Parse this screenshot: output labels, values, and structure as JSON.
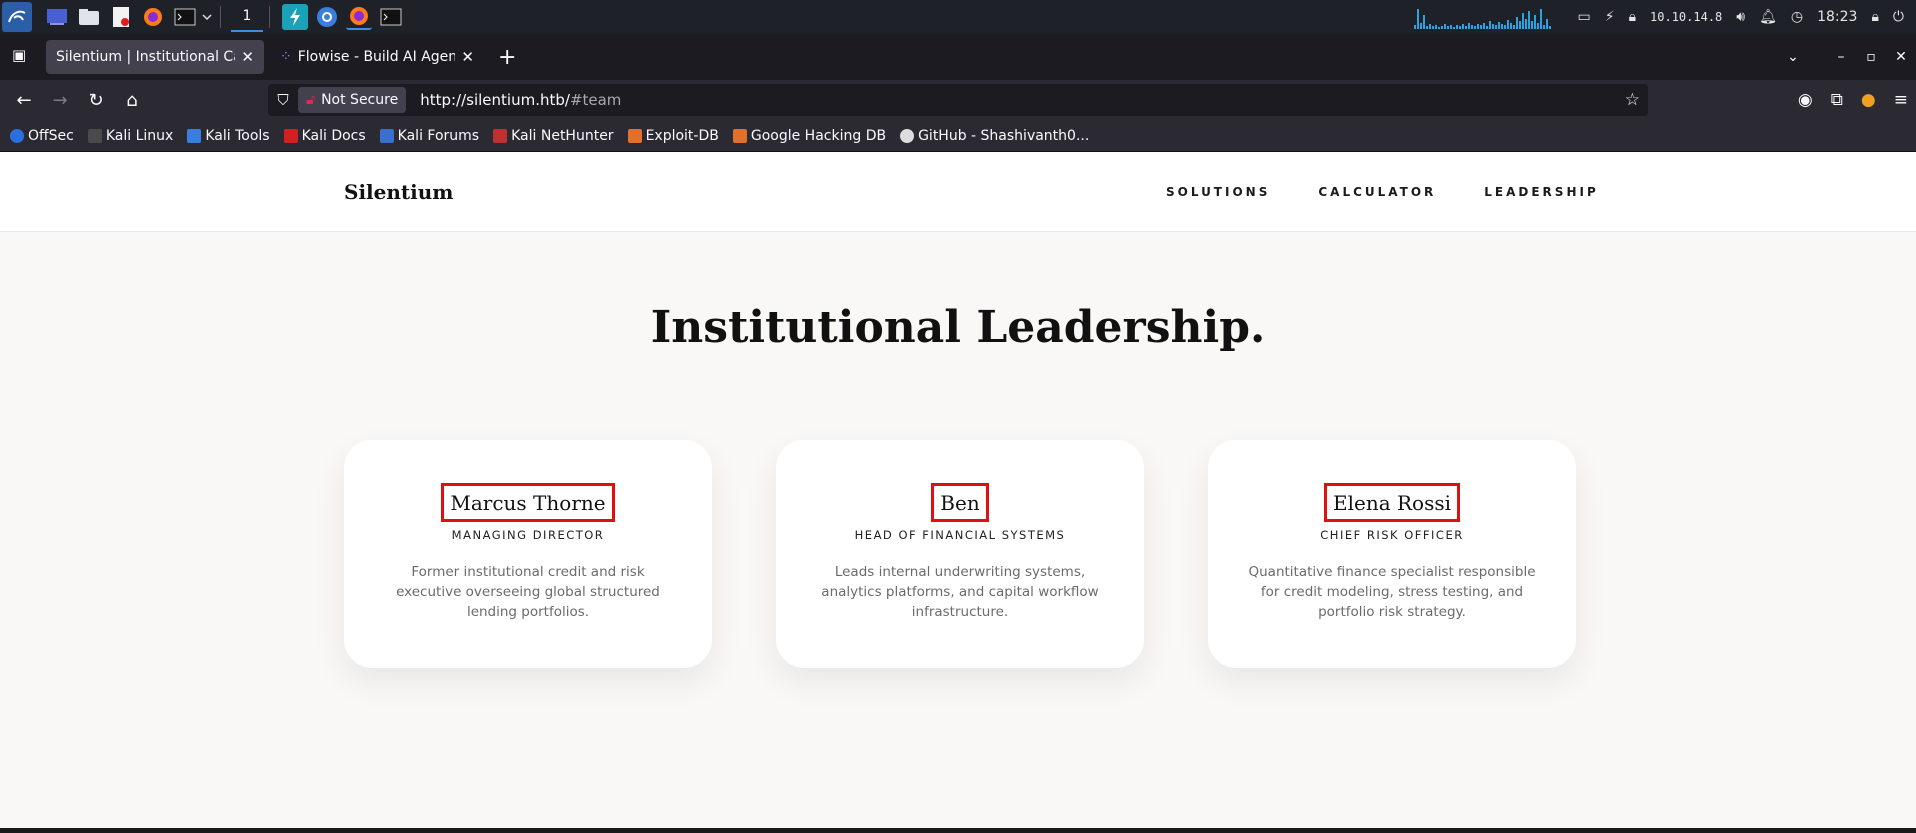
{
  "taskbar": {
    "workspace": "1",
    "ip": "10.10.14.8",
    "clock": "18:23"
  },
  "browser": {
    "tabs": [
      {
        "title": "Silentium | Institutional Capit",
        "active": true
      },
      {
        "title": "Flowise - Build AI Agents, ",
        "active": false
      }
    ],
    "security_label": "Not Secure",
    "url_host": "http://silentium.htb/",
    "url_fragment": "#team",
    "bookmarks": [
      "OffSec",
      "Kali Linux",
      "Kali Tools",
      "Kali Docs",
      "Kali Forums",
      "Kali NetHunter",
      "Exploit-DB",
      "Google Hacking DB",
      "GitHub - Shashivanth0..."
    ]
  },
  "site": {
    "logo": "Silentium",
    "nav": [
      "SOLUTIONS",
      "CALCULATOR",
      "LEADERSHIP"
    ],
    "section_title": "Institutional Leadership.",
    "team": [
      {
        "name": "Marcus Thorne",
        "role": "MANAGING DIRECTOR",
        "bio": "Former institutional credit and risk executive overseeing global structured lending portfolios."
      },
      {
        "name": "Ben",
        "role": "HEAD OF FINANCIAL SYSTEMS",
        "bio": "Leads internal underwriting systems, analytics platforms, and capital workflow infrastructure."
      },
      {
        "name": "Elena Rossi",
        "role": "CHIEF RISK OFFICER",
        "bio": "Quantitative finance specialist responsible for credit modeling, stress testing, and portfolio risk strategy."
      }
    ],
    "highlight_color": "#e01010"
  }
}
